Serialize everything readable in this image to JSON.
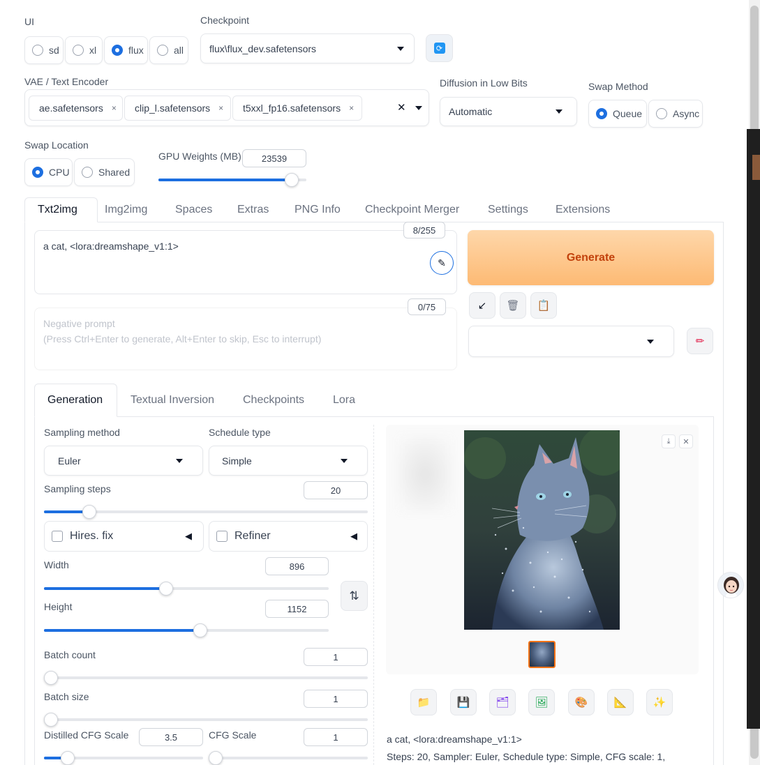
{
  "ui": {
    "label": "UI",
    "options": [
      "sd",
      "xl",
      "flux",
      "all"
    ],
    "selected": "flux"
  },
  "checkpoint": {
    "label": "Checkpoint",
    "value": "flux\\flux_dev.safetensors",
    "refresh_icon": "refresh-icon"
  },
  "vae": {
    "label": "VAE / Text Encoder",
    "chips": [
      "ae.safetensors",
      "clip_l.safetensors",
      "t5xxl_fp16.safetensors"
    ],
    "remove_glyph": "×",
    "clear_glyph": "✕"
  },
  "diffusion_low_bits": {
    "label": "Diffusion in Low Bits",
    "value": "Automatic"
  },
  "swap_method": {
    "label": "Swap Method",
    "options": [
      "Queue",
      "Async"
    ],
    "selected": "Queue"
  },
  "swap_location": {
    "label": "Swap Location",
    "options": [
      "CPU",
      "Shared"
    ],
    "selected": "CPU"
  },
  "gpu_weights": {
    "label": "GPU Weights (MB)",
    "value": "23539",
    "fraction": 0.9
  },
  "main_tabs": [
    "Txt2img",
    "Img2img",
    "Spaces",
    "Extras",
    "PNG Info",
    "Checkpoint Merger",
    "Settings",
    "Extensions"
  ],
  "prompt": {
    "text": "a cat, <lora:dreamshape_v1:1>",
    "counter": "8/255"
  },
  "negative_prompt": {
    "placeholder_line1": "Negative prompt",
    "placeholder_line2": "(Press Ctrl+Enter to generate, Alt+Enter to skip, Esc to interrupt)",
    "counter": "0/75"
  },
  "generate": {
    "label": "Generate"
  },
  "action_icons": {
    "arrow": "↙",
    "trash": "🗑",
    "clipboard": "📋",
    "pencil": "✏"
  },
  "sub_tabs": [
    "Generation",
    "Textual Inversion",
    "Checkpoints",
    "Lora"
  ],
  "sampling_method": {
    "label": "Sampling method",
    "value": "Euler"
  },
  "schedule_type": {
    "label": "Schedule type",
    "value": "Simple"
  },
  "sampling_steps": {
    "label": "Sampling steps",
    "value": "20",
    "fraction": 0.14
  },
  "hires_fix": {
    "label": "Hires. fix",
    "toggle": "◀"
  },
  "refiner": {
    "label": "Refiner",
    "toggle": "◀"
  },
  "width": {
    "label": "Width",
    "value": "896",
    "fraction": 0.43
  },
  "height": {
    "label": "Height",
    "value": "1152",
    "fraction": 0.55
  },
  "swap_dims_icon": "⇅",
  "batch_count": {
    "label": "Batch count",
    "value": "1",
    "fraction": 0.0
  },
  "batch_size": {
    "label": "Batch size",
    "value": "1",
    "fraction": 0.0
  },
  "distilled_cfg": {
    "label": "Distilled CFG Scale",
    "value": "3.5",
    "fraction": 0.15
  },
  "cfg_scale": {
    "label": "CFG Scale",
    "value": "1",
    "fraction": 0.0
  },
  "output": {
    "download_glyph": "⤓",
    "close_glyph": "✕",
    "tool_icons": [
      "📁",
      "💾",
      "🗂",
      "🖼",
      "🎨",
      "📐",
      "✨"
    ],
    "info_line1": "a cat, <lora:dreamshape_v1:1>",
    "info_line2": "Steps: 20, Sampler: Euler, Schedule type: Simple, CFG scale: 1,"
  },
  "colors": {
    "accent": "#1d6fe0",
    "generate_gradient_start": "#fed7aa",
    "generate_gradient_end": "#fdba74",
    "generate_text": "#c2410c"
  }
}
